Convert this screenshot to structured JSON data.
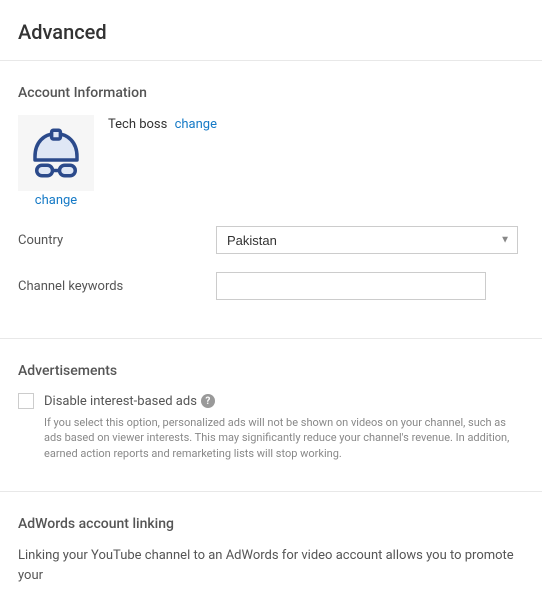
{
  "page": {
    "title": "Advanced"
  },
  "account": {
    "section_title": "Account Information",
    "avatar_change": "change",
    "name": "Tech boss",
    "name_change": "change",
    "country_label": "Country",
    "country_value": "Pakistan",
    "keywords_label": "Channel keywords",
    "keywords_value": ""
  },
  "ads": {
    "section_title": "Advertisements",
    "disable_label": "Disable interest-based ads",
    "help_text": "If you select this option, personalized ads will not be shown on videos on your channel, such as ads based on viewer interests. This may significantly reduce your channel's revenue. In addition, earned action reports and remarketing lists will stop working."
  },
  "adwords": {
    "section_title": "AdWords account linking",
    "desc": "Linking your YouTube channel to an AdWords for video account allows you to promote your"
  }
}
